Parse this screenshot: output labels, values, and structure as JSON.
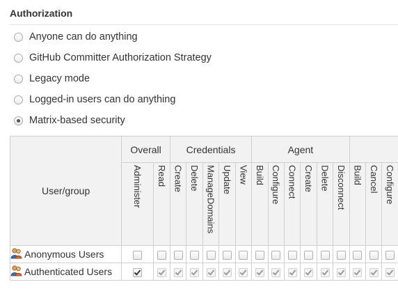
{
  "section": {
    "title": "Authorization"
  },
  "strategies": [
    {
      "label": "Anyone can do anything",
      "selected": false
    },
    {
      "label": "GitHub Committer Authorization Strategy",
      "selected": false
    },
    {
      "label": "Legacy mode",
      "selected": false
    },
    {
      "label": "Logged-in users can do anything",
      "selected": false
    },
    {
      "label": "Matrix-based security",
      "selected": true
    }
  ],
  "matrix": {
    "user_group_header": "User/group",
    "groups": [
      {
        "label": "Overall"
      },
      {
        "label": "Credentials"
      },
      {
        "label": "Agent"
      }
    ],
    "permissions": [
      "Administer",
      "Read",
      "Create",
      "Delete",
      "ManageDomains",
      "Update",
      "View",
      "Build",
      "Configure",
      "Connect",
      "Create",
      "Delete",
      "Disconnect",
      "Build",
      "Cancel",
      "Configure"
    ],
    "users": [
      {
        "name": "Anonymous Users",
        "checked": [
          false,
          false,
          false,
          false,
          false,
          false,
          false,
          false,
          false,
          false,
          false,
          false,
          false,
          false,
          false,
          false
        ],
        "disabled": [
          false,
          false,
          false,
          false,
          false,
          false,
          false,
          false,
          false,
          false,
          false,
          false,
          false,
          false,
          false,
          false
        ]
      },
      {
        "name": "Authenticated Users",
        "checked": [
          true,
          true,
          true,
          true,
          true,
          true,
          true,
          true,
          true,
          true,
          true,
          true,
          true,
          true,
          true,
          true
        ],
        "disabled": [
          false,
          true,
          true,
          true,
          true,
          true,
          true,
          true,
          true,
          true,
          true,
          true,
          true,
          true,
          true,
          true
        ]
      }
    ]
  }
}
